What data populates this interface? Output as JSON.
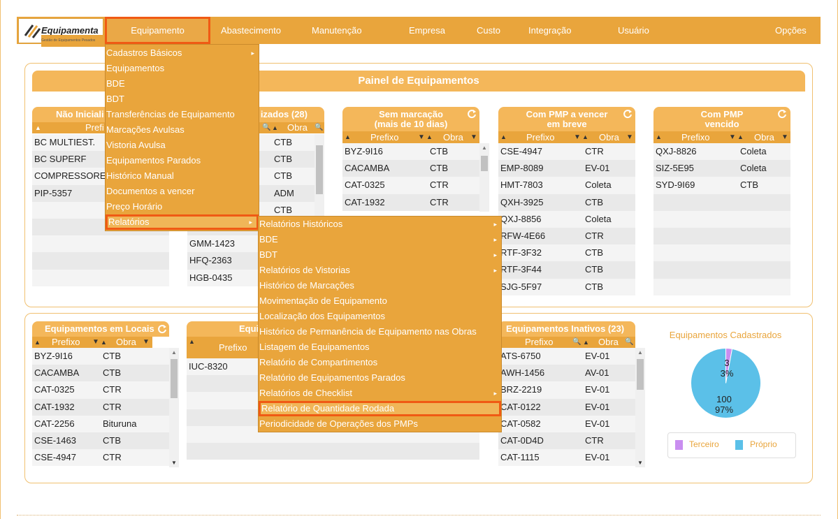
{
  "logo": {
    "name": "Equipamenta",
    "tagline": "Gestão de Equipamentos Pesados"
  },
  "nav": [
    "Equipamento",
    "Abastecimento",
    "Manutenção",
    "Empresa",
    "Custo",
    "Integração",
    "Usuário",
    "Opções"
  ],
  "panel_title": "Painel de Equipamentos",
  "box_nao_iniciali": {
    "title": "Não Iniciali",
    "col1": "Prefi",
    "rows": [
      "BC MULTIEST.",
      "BC SUPERF",
      "COMPRESSORE",
      "PIP-5357"
    ]
  },
  "box_utilizados": {
    "title": "izados (28)",
    "col2": "Obra",
    "rows": [
      [
        "",
        "CTB"
      ],
      [
        "",
        "CTB"
      ],
      [
        "",
        "CTB"
      ],
      [
        "",
        "ADM"
      ],
      [
        "",
        "CTB"
      ],
      [
        "",
        ""
      ],
      [
        "GMM-1423",
        ""
      ],
      [
        "HFQ-2363",
        ""
      ],
      [
        "HGB-0435",
        ""
      ]
    ]
  },
  "box_sem_marcacao": {
    "title1": "Sem marcação",
    "title2": "(mais de 10 dias)",
    "col1": "Prefixo",
    "col2": "Obra",
    "rows": [
      [
        "BYZ-9I16",
        "CTB"
      ],
      [
        "CACAMBA",
        "CTB"
      ],
      [
        "CAT-0325",
        "CTR"
      ],
      [
        "CAT-1932",
        "CTR"
      ]
    ]
  },
  "box_pmp_vencer": {
    "title1": "Com PMP a vencer",
    "title2": "em breve",
    "col1": "Prefixo",
    "col2": "Obra",
    "rows": [
      [
        "CSE-4947",
        "CTR"
      ],
      [
        "EMP-8089",
        "EV-01"
      ],
      [
        "HMT-7803",
        "Coleta"
      ],
      [
        "QXH-3925",
        "CTB"
      ],
      [
        "QXJ-8856",
        "Coleta"
      ],
      [
        "RFW-4E66",
        "CTR"
      ],
      [
        "RTF-3F32",
        "CTB"
      ],
      [
        "RTF-3F44",
        "CTB"
      ],
      [
        "SJG-5F97",
        "CTB"
      ]
    ]
  },
  "box_pmp_vencido": {
    "title1": "Com PMP",
    "title2": "vencido",
    "col1": "Prefixo",
    "col2": "Obra",
    "rows": [
      [
        "QXJ-8826",
        "Coleta"
      ],
      [
        "SIZ-5E95",
        "Coleta"
      ],
      [
        "SYD-9I69",
        "CTB"
      ]
    ]
  },
  "box_locais": {
    "title": "Equipamentos em Locais",
    "col1": "Prefixo",
    "col2": "Obra",
    "rows": [
      [
        "BYZ-9I16",
        "CTB"
      ],
      [
        "CACAMBA",
        "CTB"
      ],
      [
        "CAT-0325",
        "CTR"
      ],
      [
        "CAT-1932",
        "CTR"
      ],
      [
        "CAT-2256",
        "Bituruna"
      ],
      [
        "CSE-1463",
        "CTB"
      ],
      [
        "CSE-4947",
        "CTR"
      ]
    ]
  },
  "box_equi": {
    "title": "Equi",
    "col1": "Prefixo",
    "rows": [
      "IUC-8320"
    ]
  },
  "box_inativos": {
    "title": "Equipamentos Inativos (23)",
    "col1": "Prefixo",
    "col2": "Obra",
    "rows": [
      [
        "ATS-6750",
        "EV-01"
      ],
      [
        "AWH-1456",
        "AV-01"
      ],
      [
        "BRZ-2219",
        "EV-01"
      ],
      [
        "CAT-0122",
        "EV-01"
      ],
      [
        "CAT-0582",
        "EV-01"
      ],
      [
        "CAT-0D4D",
        "CTR"
      ],
      [
        "CAT-1115",
        "EV-01"
      ]
    ]
  },
  "pie": {
    "title": "Equipamentos Cadastrados",
    "slices": [
      {
        "label": "Terceiro",
        "value": 3,
        "pct": "3%",
        "color": "#c98ef0"
      },
      {
        "label": "Próprio",
        "value": 100,
        "pct": "97%",
        "color": "#5bc0e8"
      }
    ]
  },
  "menu1": [
    {
      "label": "Cadastros Básicos",
      "sub": true
    },
    {
      "label": "Equipamentos"
    },
    {
      "label": "BDE"
    },
    {
      "label": "BDT"
    },
    {
      "label": "Transferências de Equipamento"
    },
    {
      "label": "Marcações Avulsas"
    },
    {
      "label": "Vistoria Avulsa"
    },
    {
      "label": "Equipamentos Parados"
    },
    {
      "label": "Histórico Manual"
    },
    {
      "label": "Documentos a vencer"
    },
    {
      "label": "Preço Horário"
    },
    {
      "label": "Relatórios",
      "sub": true
    }
  ],
  "menu2": [
    {
      "label": "Relatórios Históricos",
      "sub": true
    },
    {
      "label": "BDE",
      "sub": true
    },
    {
      "label": "BDT",
      "sub": true
    },
    {
      "label": "Relatórios de Vistorias",
      "sub": true
    },
    {
      "label": "Histórico de Marcações"
    },
    {
      "label": "Movimentação de Equipamento"
    },
    {
      "label": "Localização dos Equipamentos"
    },
    {
      "label": "Histórico de Permanência de Equipamento nas Obras"
    },
    {
      "label": "Listagem de Equipamentos"
    },
    {
      "label": "Relatório de Compartimentos"
    },
    {
      "label": "Relatório de Equipamentos Parados"
    },
    {
      "label": "Relatórios de Checklist",
      "sub": true
    },
    {
      "label": "Relatório de Quantidade Rodada"
    },
    {
      "label": "Periodicidade de Operações dos PMPs"
    }
  ],
  "icons": {
    "sort": "sort-icon",
    "filter": "filter-icon",
    "search": "search-icon",
    "refresh": "refresh-icon",
    "submenu": "chevron-right-icon"
  }
}
